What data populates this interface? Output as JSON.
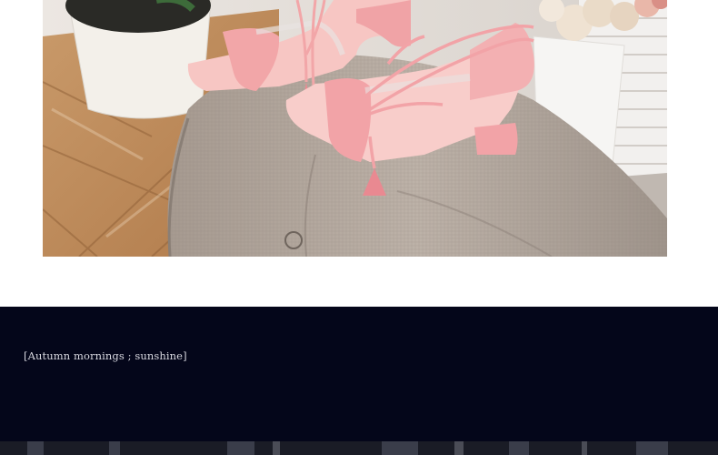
{
  "photo": {
    "subject": "pink lace-up block heel sandals with tassels on a linen armchair"
  },
  "banner": {
    "caption": "[Autumn mornings ; sunshine]",
    "background": "#04061a"
  }
}
